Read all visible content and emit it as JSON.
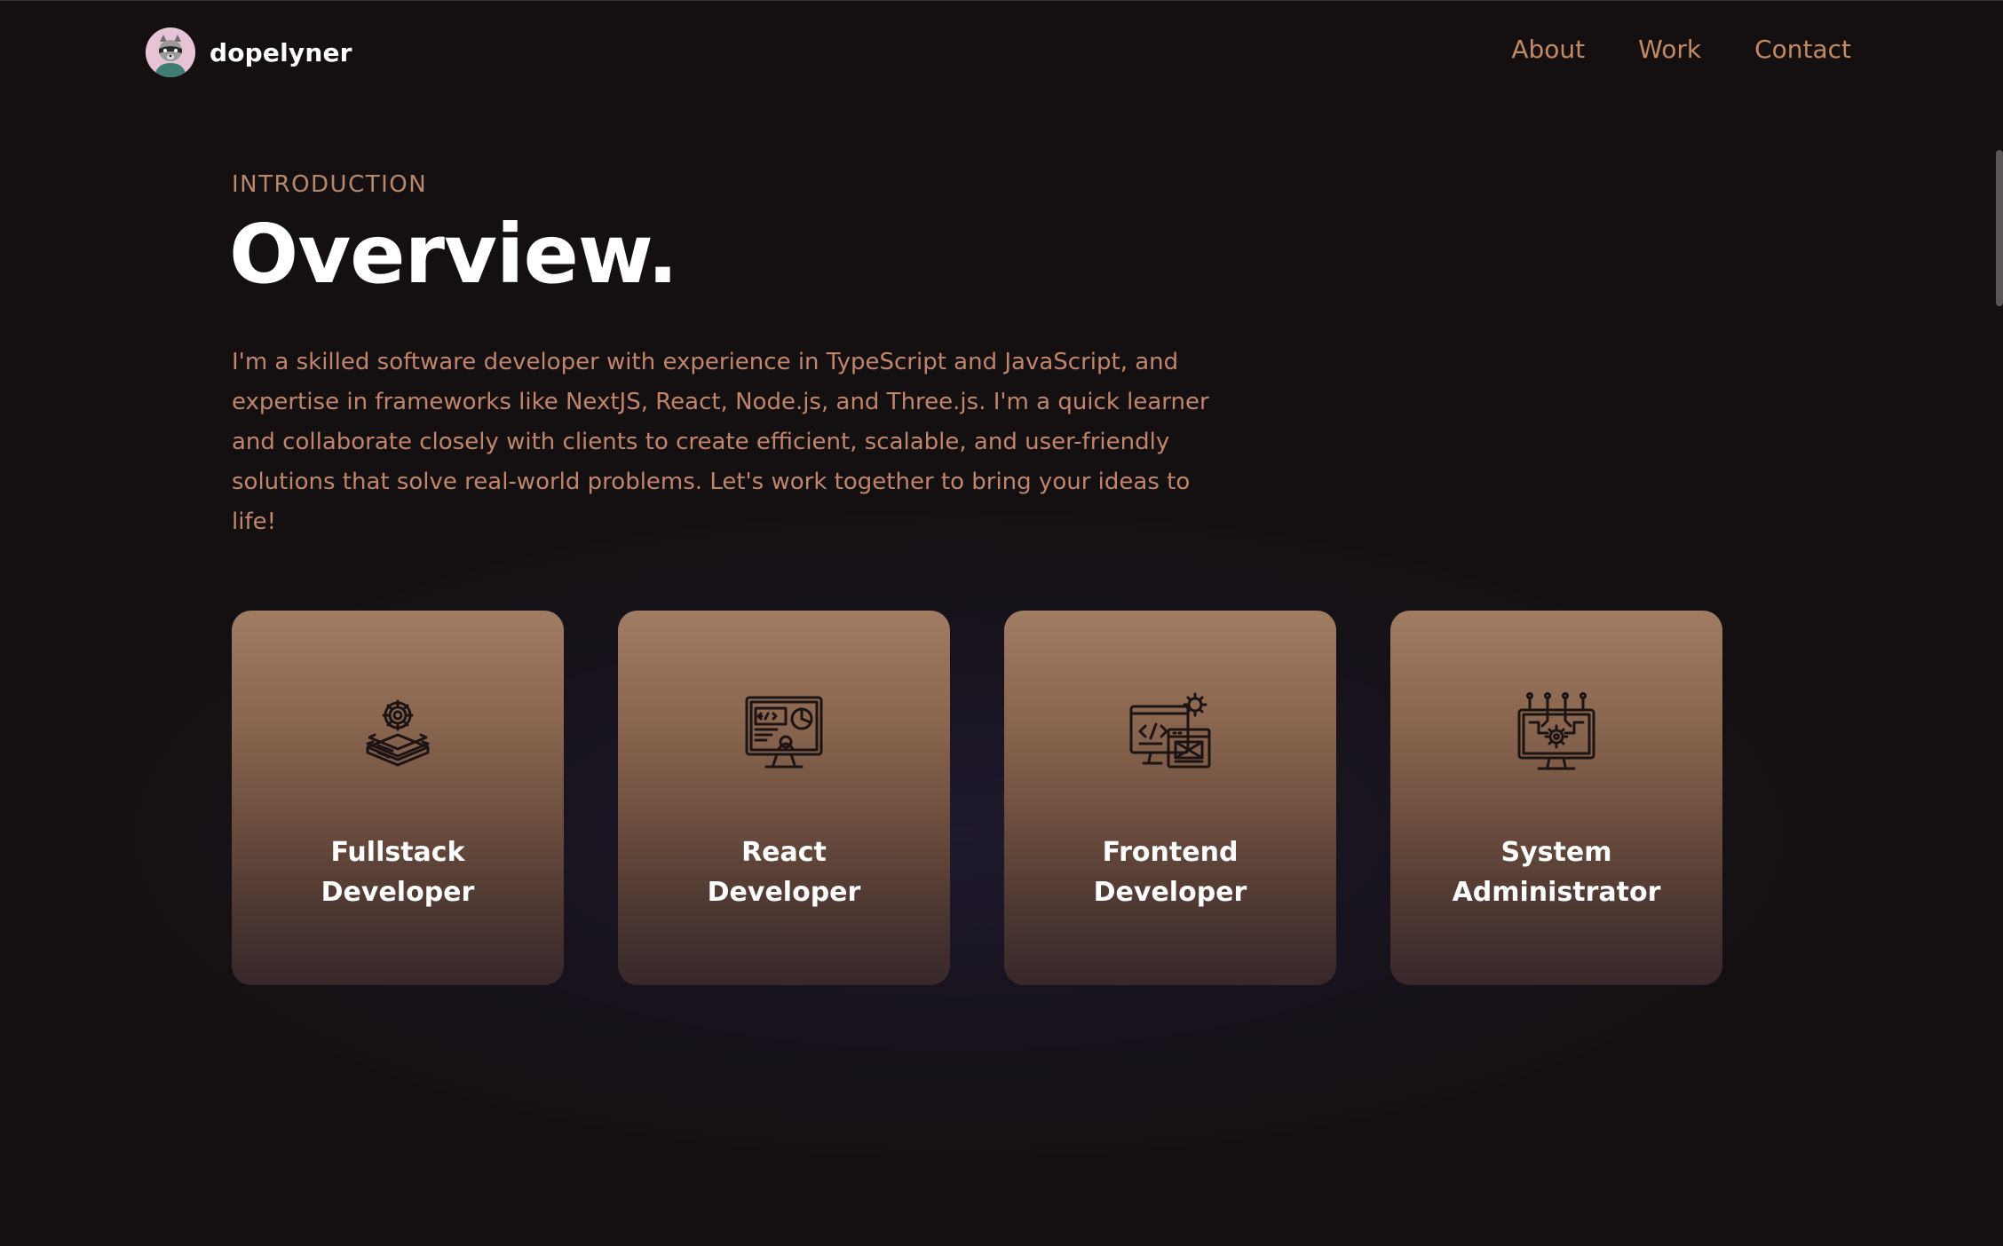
{
  "nav": {
    "brand_name": "dopelyner",
    "avatar_icon": "raccoon-avatar-icon",
    "links": [
      {
        "label": "About"
      },
      {
        "label": "Work"
      },
      {
        "label": "Contact"
      }
    ]
  },
  "intro": {
    "eyebrow": "INTRODUCTION",
    "title": "Overview.",
    "paragraph": "I'm a skilled software developer with experience in TypeScript and JavaScript, and expertise in frameworks like NextJS, React, Node.js, and Three.js. I'm a quick learner and collaborate closely with clients to create efficient, scalable, and user-friendly solutions that solve real-world problems. Let's work together to bring your ideas to life!"
  },
  "services": [
    {
      "title": "Fullstack Developer",
      "icon": "layered-stack-gear-icon"
    },
    {
      "title": "React Developer",
      "icon": "monitor-dashboard-icon"
    },
    {
      "title": "Frontend Developer",
      "icon": "code-window-gear-icon"
    },
    {
      "title": "System Administrator",
      "icon": "monitor-circuit-gear-icon"
    }
  ],
  "colors": {
    "background": "#141011",
    "accent": "#c48a62",
    "card_top": "#a07c63",
    "card_bottom": "#38282a",
    "heading": "#ffffff"
  }
}
